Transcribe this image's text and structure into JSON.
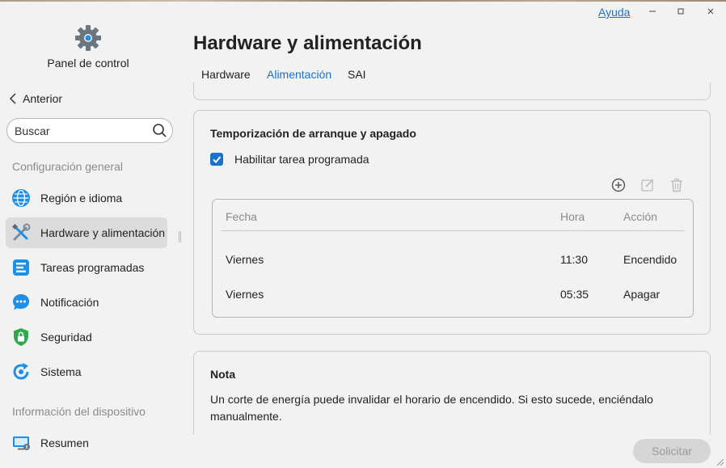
{
  "window": {
    "help_label": "Ayuda",
    "minimize_icon": "minimize-icon",
    "maximize_icon": "maximize-icon",
    "close_icon": "close-icon"
  },
  "sidebar": {
    "app_title": "Panel de control",
    "back_label": "Anterior",
    "search_placeholder": "Buscar",
    "section_general": "Configuración general",
    "section_device": "Información del dispositivo",
    "items": [
      {
        "label": "Región e idioma",
        "icon": "globe-icon"
      },
      {
        "label": "Hardware y alimentación",
        "icon": "tools-icon",
        "active": true
      },
      {
        "label": "Tareas programadas",
        "icon": "tasks-icon"
      },
      {
        "label": "Notificación",
        "icon": "chat-bubble-icon"
      },
      {
        "label": "Seguridad",
        "icon": "shield-lock-icon"
      },
      {
        "label": "Sistema",
        "icon": "system-refresh-icon"
      },
      {
        "label": "Resumen",
        "icon": "monitor-icon"
      }
    ]
  },
  "main": {
    "title": "Hardware y alimentación",
    "tabs": [
      {
        "label": "Hardware",
        "active": false
      },
      {
        "label": "Alimentación",
        "active": true
      },
      {
        "label": "SAI",
        "active": false
      }
    ],
    "schedule_card": {
      "title": "Temporización de arranque y apagado",
      "enable_label": "Habilitar tarea programada",
      "enable_checked": true,
      "tools": [
        "add-icon",
        "edit-icon",
        "delete-icon"
      ],
      "columns": [
        "Fecha",
        "Hora",
        "Acción"
      ],
      "rows": [
        [
          "Viernes",
          "11:30",
          "Encendido"
        ],
        [
          "Viernes",
          "05:35",
          "Apagar"
        ]
      ]
    },
    "note_card": {
      "title": "Nota",
      "text": "Un corte de energía puede invalidar el horario de encendido. Si esto sucede, enciéndalo manualmente."
    },
    "apply_label": "Solicitar"
  },
  "colors": {
    "accent": "#1a73c9",
    "background": "#f2f2f2",
    "active_nav": "#dcdcdc",
    "disabled_button": "#d6d6d6"
  }
}
